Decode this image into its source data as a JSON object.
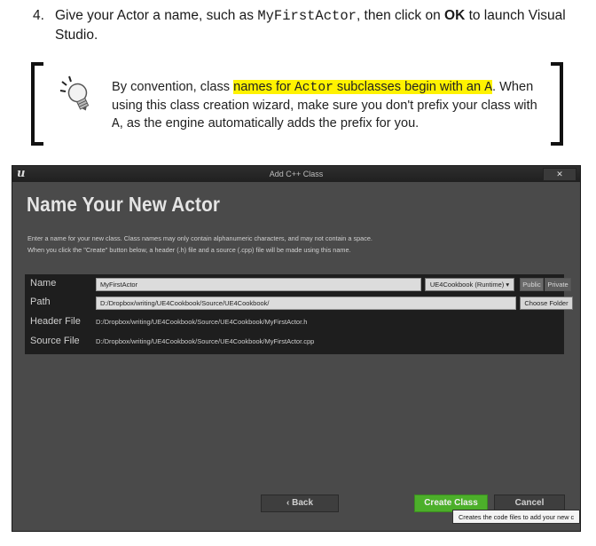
{
  "step": {
    "number": "4.",
    "text_part1": "Give your Actor a name, such as ",
    "code_example": "MyFirstActor",
    "text_part2": ", then click on ",
    "bold_ok": "OK",
    "text_part3": " to launch Visual Studio."
  },
  "tip": {
    "icon": "lightbulb-icon",
    "part1": "By convention, class ",
    "hl_part1": "names for ",
    "hl_code": "Actor",
    "hl_part2": " subclasses begin with an ",
    "hl_code_a": "A",
    "part2": ".",
    "line2_part1": "When using this class creation wizard, make sure you don't prefix your class with ",
    "line2_code": "A",
    "line2_part2": ", as the engine automatically adds the prefix for you."
  },
  "dialog": {
    "window_title": "Add C++ Class",
    "logo_text": "u",
    "close_label": "✕",
    "heading": "Name Your New Actor",
    "description_line1": "Enter a name for your new class. Class names may only contain alphanumeric characters, and may not contain a space.",
    "description_line2": "When you click the \"Create\" button below, a header (.h) file and a source (.cpp) file will be made using this name.",
    "fields": {
      "name_label": "Name",
      "name_value": "MyFirstActor",
      "module_select": "UE4Cookbook (Runtime) ▾",
      "public_label": "Public",
      "private_label": "Private",
      "path_label": "Path",
      "path_value": "D:/Dropbox/writing/UE4Cookbook/Source/UE4Cookbook/",
      "choose_folder_label": "Choose Folder",
      "header_label": "Header File",
      "header_value": "D:/Dropbox/writing/UE4Cookbook/Source/UE4Cookbook/MyFirstActor.h",
      "source_label": "Source File",
      "source_value": "D:/Dropbox/writing/UE4Cookbook/Source/UE4Cookbook/MyFirstActor.cpp"
    },
    "buttons": {
      "back": "‹ Back",
      "create": "Create Class",
      "cancel": "Cancel"
    },
    "tooltip": "Creates the code files to add your new c"
  }
}
